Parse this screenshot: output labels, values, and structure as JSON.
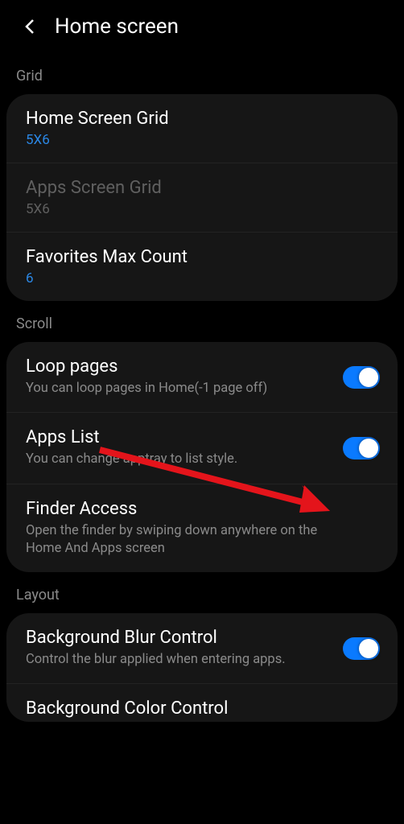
{
  "header": {
    "title": "Home screen"
  },
  "sections": {
    "grid": {
      "label": "Grid",
      "home_screen_grid": {
        "title": "Home Screen Grid",
        "value": "5X6"
      },
      "apps_screen_grid": {
        "title": "Apps Screen Grid",
        "value": "5X6"
      },
      "favorites_max": {
        "title": "Favorites Max Count",
        "value": "6"
      }
    },
    "scroll": {
      "label": "Scroll",
      "loop_pages": {
        "title": "Loop pages",
        "desc": "You can loop pages in Home(-1 page off)"
      },
      "apps_list": {
        "title": "Apps List",
        "desc": "You can change apptray to list style."
      },
      "finder_access": {
        "title": "Finder Access",
        "desc": "Open the finder by swiping down anywhere on the Home And Apps screen"
      }
    },
    "layout": {
      "label": "Layout",
      "bg_blur": {
        "title": "Background Blur Control",
        "desc": "Control the blur applied when entering apps."
      },
      "bg_color": {
        "title": "Background Color Control"
      }
    }
  }
}
